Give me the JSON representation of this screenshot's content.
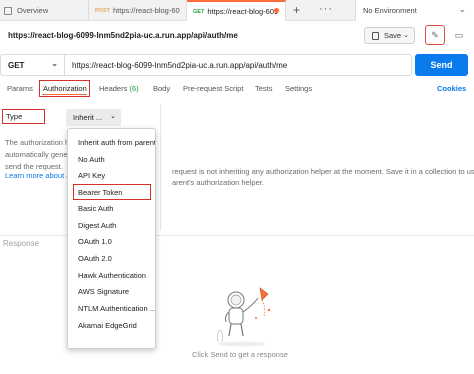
{
  "tabs": {
    "overview": "Overview",
    "tab2": {
      "method": "POST",
      "name": "https://react-blog-60"
    },
    "tab3": {
      "method": "GET",
      "name": "https://react-blog-609"
    },
    "environment": "No Environment"
  },
  "title_url": "https://react-blog-6099-lnm5nd2pia-uc.a.run.app/api/auth/me",
  "save_label": "Save",
  "request": {
    "method": "GET",
    "url": "https://react-blog-6099-lnm5nd2pia-uc.a.run.app/api/auth/me",
    "send_label": "Send"
  },
  "subtabs": {
    "params": "Params",
    "authorization": "Authorization",
    "headers": "Headers",
    "headers_count": "(6)",
    "body": "Body",
    "pre_request": "Pre-request Script",
    "tests": "Tests",
    "settings": "Settings",
    "cookies": "Cookies"
  },
  "auth": {
    "type_label": "Type",
    "selected": "Inherit ...",
    "desc_lines": [
      "The authorization he",
      "automatically gener",
      "send the request."
    ],
    "learn_more": "Learn more about a",
    "right_lines": [
      "request is not inheriting any authorization helper at the moment. Save it in a collection to use t",
      "arent's authorization helper."
    ]
  },
  "dropdown_options": [
    "Inherit auth from parent",
    "No Auth",
    "API Key",
    "Bearer Token",
    "Basic Auth",
    "Digest Auth",
    "OAuth 1.0",
    "OAuth 2.0",
    "Hawk Authentication",
    "AWS Signature",
    "NTLM Authentication ...",
    "Akamai EdgeGrid"
  ],
  "highlighted_option": "Bearer Token",
  "response": {
    "label": "Response",
    "empty_message": "Click Send to get a response"
  },
  "colors": {
    "accent": "#ff6c37",
    "send": "#097bed",
    "highlight_border": "#d6322b",
    "headers_count": "#1f9c3b"
  },
  "icons": [
    "overview-icon",
    "plus-icon",
    "more-icon",
    "save-icon",
    "edit-icon",
    "comment-icon",
    "chevron-down-icon",
    "astronaut-illustration"
  ]
}
